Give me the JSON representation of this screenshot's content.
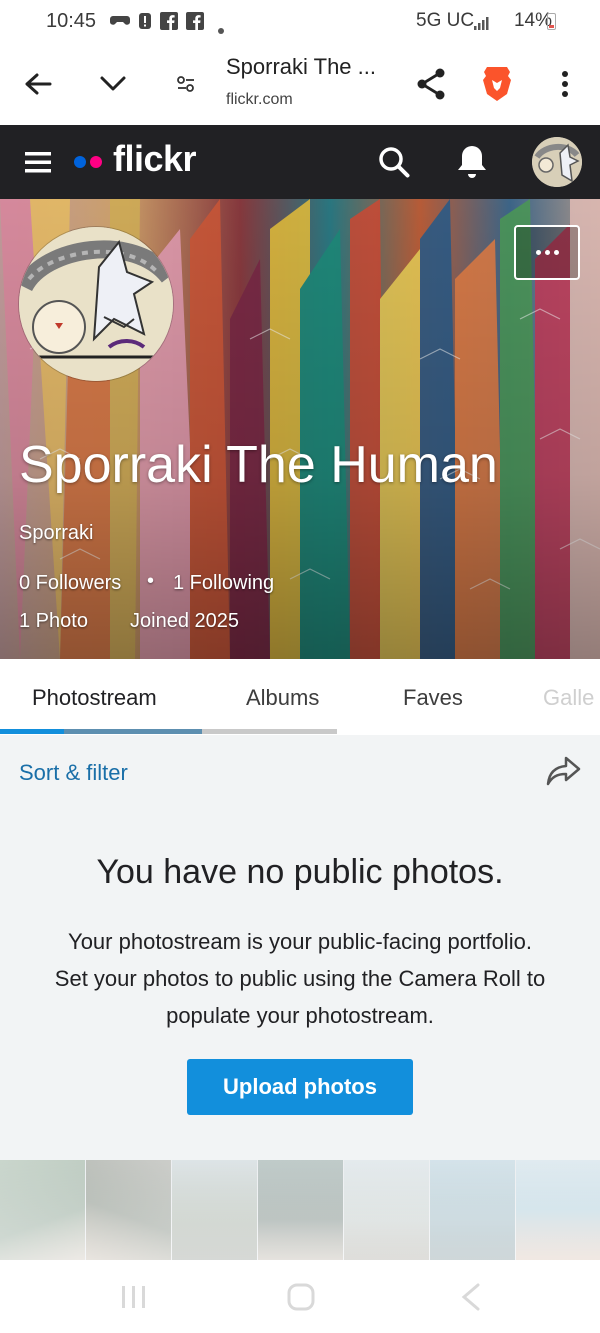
{
  "status_bar": {
    "time": "10:45",
    "network": "5G UC",
    "battery": "14%",
    "battery_level": 0.14
  },
  "browser": {
    "tab_title": "Sporraki The ...",
    "url": "flickr.com",
    "icons": [
      "back-arrow-icon",
      "chevron-down-icon",
      "tune-icon",
      "share-icon",
      "brave-lion-icon",
      "more-vertical-icon"
    ]
  },
  "flickr_nav": {
    "logo": "flickr",
    "colors": {
      "blue_dot": "#0063dc",
      "pink_dot": "#ff0084",
      "bar": "#212124"
    },
    "icons": [
      "menu-icon",
      "search-icon",
      "bell-icon",
      "avatar"
    ]
  },
  "profile": {
    "display_name": "Sporraki The Human",
    "username": "Sporraki",
    "followers": "0 Followers",
    "separator": "•",
    "following": "1 Following",
    "photos": "1 Photo",
    "joined": "Joined 2025"
  },
  "tabs": [
    {
      "label": "Photostream",
      "active": true
    },
    {
      "label": "Albums",
      "active": false
    },
    {
      "label": "Faves",
      "active": false
    },
    {
      "label": "Galle",
      "active": false
    }
  ],
  "content": {
    "sort_filter": "Sort & filter",
    "empty_title": "You have no public photos.",
    "empty_desc_line1": "Your photostream is your public-facing portfolio.",
    "empty_desc_line2": "Set your photos to public using the Camera Roll to",
    "empty_desc_line3": "populate your photostream.",
    "upload_button": "Upload photos",
    "accent": "#128fdc",
    "link_color": "#1a6fa8"
  }
}
